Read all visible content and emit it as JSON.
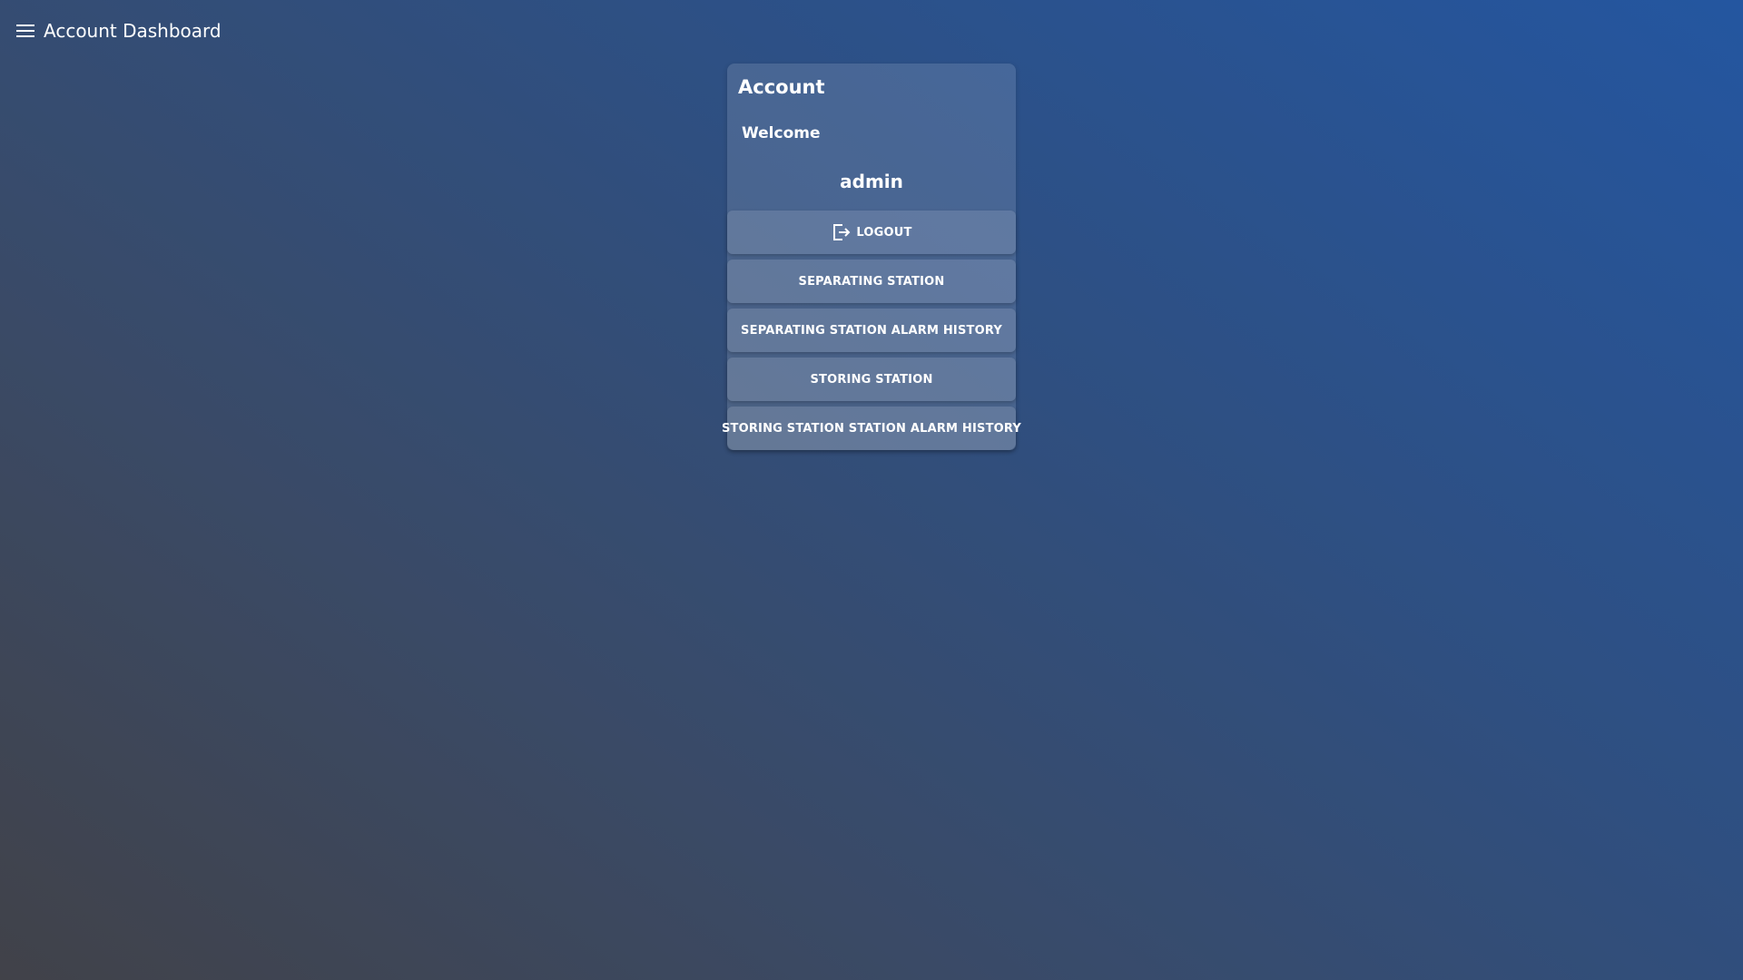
{
  "header": {
    "title": "Account Dashboard",
    "menu_icon": "hamburger-menu-icon"
  },
  "card": {
    "title": "Account",
    "welcome": "Welcome",
    "username": "admin"
  },
  "buttons": {
    "logout": {
      "label": "LOGOUT",
      "icon": "logout-icon"
    },
    "separating_station": {
      "label": "SEPARATING STATION"
    },
    "separating_station_alarm_history": {
      "label": "SEPARATING STATION ALARM HISTORY"
    },
    "storing_station": {
      "label": "STORING STATION"
    },
    "storing_station_alarm_history": {
      "label": "STORING STATION STATION ALARM HISTORY"
    }
  },
  "colors": {
    "background_start": "#414249",
    "background_end": "#2456a0",
    "text": "#ffffff"
  }
}
